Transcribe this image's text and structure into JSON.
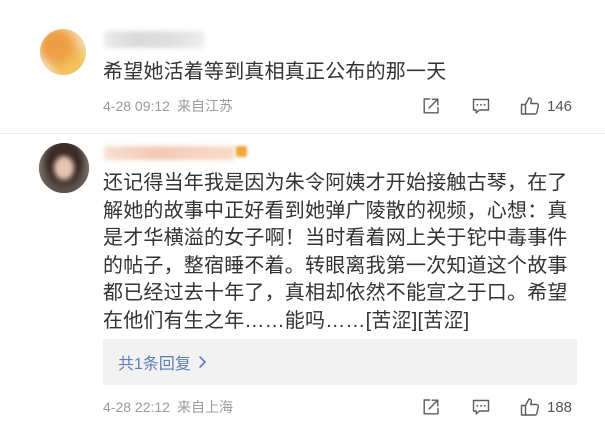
{
  "comments": [
    {
      "body_lines": [
        "希望她活着等到真相真正公布的那一天"
      ],
      "time": "4-28 09:12",
      "source": "来自江苏",
      "likes": "146"
    },
    {
      "body_lines": [
        "还记得当年我是因为朱令阿姨才开始接触古琴，在了",
        "解她的故事中正好看到她弹广陵散的视频，心想：真",
        "是才华横溢的女子啊！当时看着网上关于铊中毒事件",
        "的帖子，整宿睡不着。转眼离我第一次知道这个故事",
        "都已经过去十年了，真相却依然不能宣之于口。希望",
        "在他们有生之年……能吗……[苦涩][苦涩]"
      ],
      "reply_summary": "共1条回复",
      "time": "4-28 22:12",
      "source": "来自上海",
      "likes": "188"
    }
  ],
  "icons": {
    "share": "share-icon",
    "comment": "comment-icon",
    "like": "thumbs-up-icon",
    "reply_more": "chevron-right-icon"
  },
  "colors": {
    "text": "#333333",
    "meta": "#9b9b9b",
    "count": "#555555",
    "icon": "#5c5c5c",
    "link": "#5a7fb4",
    "reply_bg": "#f2f2f2",
    "divider": "#ececec"
  }
}
